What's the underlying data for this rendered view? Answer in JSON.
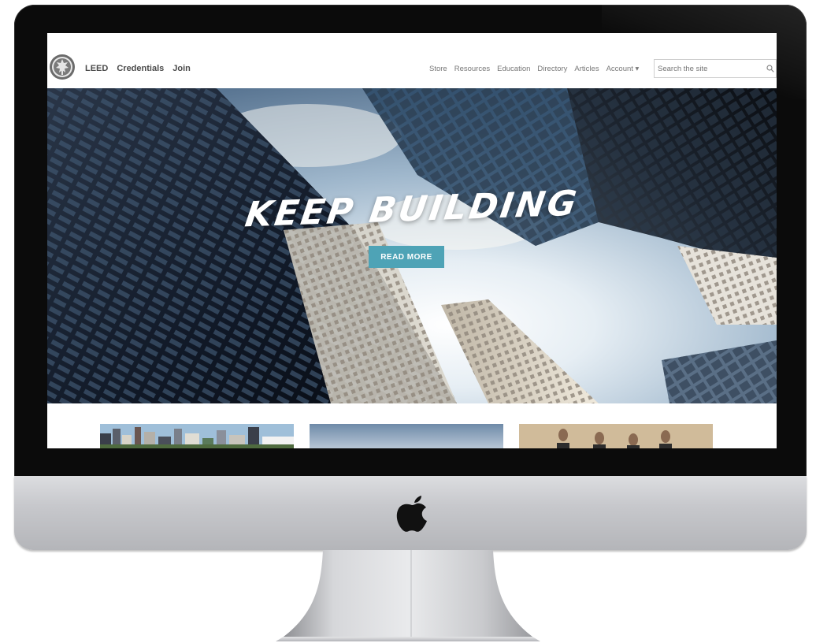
{
  "nav": {
    "primary": [
      "LEED",
      "Credentials",
      "Join"
    ],
    "secondary": [
      "Store",
      "Resources",
      "Education",
      "Directory",
      "Articles",
      "Account ▾"
    ]
  },
  "search": {
    "placeholder": "Search the site"
  },
  "hero": {
    "title": "KEEP BUILDING",
    "button": "READ MORE"
  },
  "colors": {
    "accent": "#4ea3b6",
    "bezel": "#0b0b0b",
    "aluminum": "#c7c8cc"
  },
  "icons": [
    "logo-seal-icon",
    "search-icon",
    "apple-logo-icon"
  ]
}
